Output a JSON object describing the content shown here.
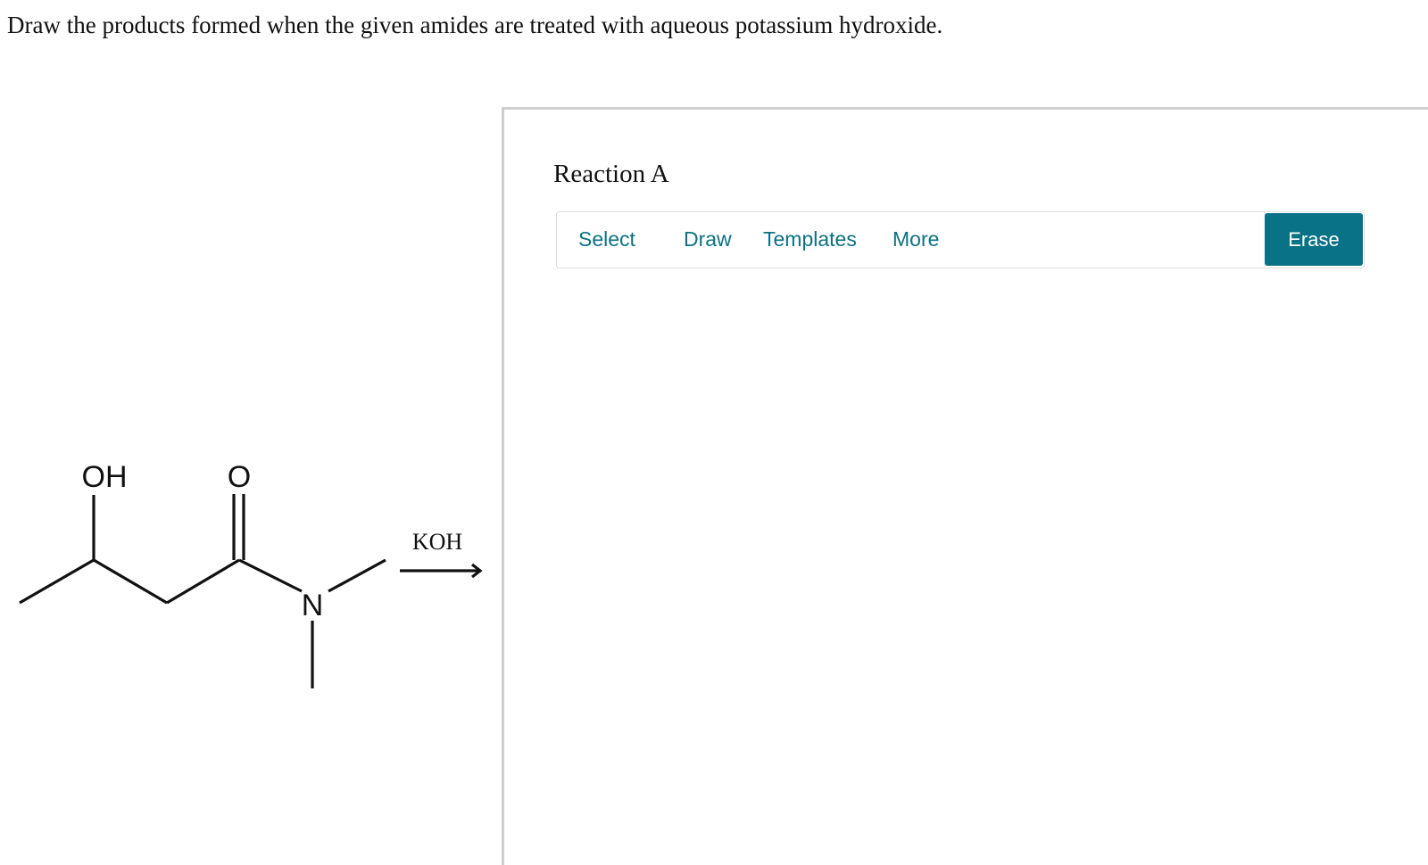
{
  "question": "Draw the products formed when the given amides are treated with aqueous potassium hydroxide.",
  "molecule": {
    "atoms": {
      "hydroxyl": "OH",
      "carbonyl_oxygen": "O",
      "nitrogen": "N"
    },
    "reagent": "KOH"
  },
  "panel": {
    "reaction_title": "Reaction A",
    "toolbar": {
      "select_label": "Select",
      "draw_label": "Draw",
      "templates_label": "Templates",
      "more_label": "More",
      "erase_label": "Erase"
    }
  },
  "colors": {
    "accent": "#0a7286",
    "border": "#cfcfcf"
  }
}
